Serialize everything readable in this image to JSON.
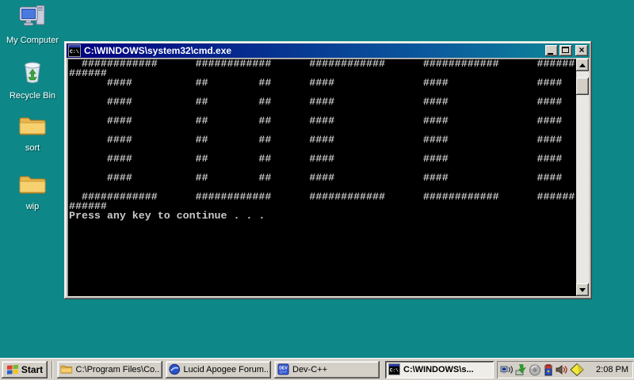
{
  "desktop": {
    "background_color": "#0d8787",
    "icons": [
      {
        "label": "My Computer",
        "icon": "my-computer-icon"
      },
      {
        "label": "Recycle Bin",
        "icon": "recycle-bin-icon"
      },
      {
        "label": "sort",
        "icon": "folder-icon"
      },
      {
        "label": "wip",
        "icon": "folder-icon"
      }
    ]
  },
  "console_window": {
    "title": "C:\\WINDOWS\\system32\\cmd.exe",
    "title_icon": "cmd-icon",
    "window_buttons": [
      "minimize",
      "maximize",
      "close"
    ],
    "colors": {
      "titlebar_gradient_start": "#000080",
      "titlebar_gradient_end": "#0e8d96",
      "background": "#000000",
      "text": "#c9c9c9"
    },
    "output_lines": [
      "  ############      ############      ############      ############      ######",
      "######",
      "      ####          ##        ##      ####              ####              ####",
      "",
      "      ####          ##        ##      ####              ####              ####",
      "",
      "      ####          ##        ##      ####              ####              ####",
      "",
      "      ####          ##        ##      ####              ####              ####",
      "",
      "      ####          ##        ##      ####              ####              ####",
      "",
      "      ####          ##        ##      ####              ####              ####",
      "",
      "  ############      ############      ############      ############      ######",
      "######",
      "Press any key to continue . . ."
    ]
  },
  "taskbar": {
    "start_label": "Start",
    "buttons": [
      {
        "label": "C:\\Program Files\\Co...",
        "icon": "folder-icon",
        "active": false
      },
      {
        "label": "Lucid Apogee Forum...",
        "icon": "globe-icon",
        "active": false
      },
      {
        "label": "Dev-C++",
        "icon": "dev-cpp-icon",
        "active": false
      },
      {
        "label": "C:\\WINDOWS\\s...",
        "icon": "cmd-icon",
        "active": true
      }
    ],
    "tray": {
      "icons": [
        "network-activity-icon",
        "safely-remove-hardware-icon",
        "gray-dial-icon",
        "battery-icon",
        "volume-icon",
        "yellow-note-icon"
      ],
      "clock": "2:08 PM"
    }
  }
}
